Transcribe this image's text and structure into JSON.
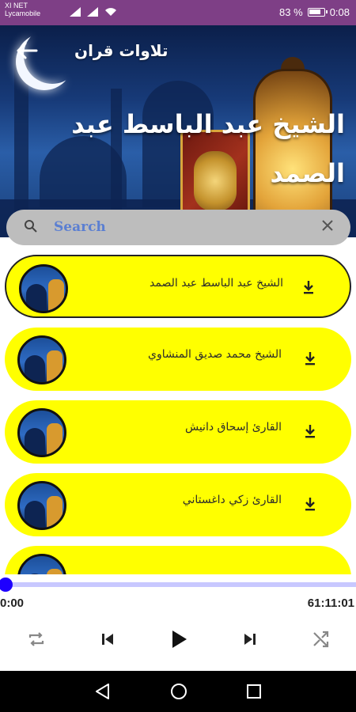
{
  "status_bar": {
    "carrier_line1": "XI NET",
    "carrier_line2": "Lycamobile",
    "battery_percent": "83 %",
    "time": "0:08"
  },
  "header": {
    "title": "تلاوات قران",
    "reciter_name": "الشيخ عبد الباسط عبد الصمد"
  },
  "search": {
    "placeholder": "Search"
  },
  "reciters": [
    {
      "name": "الشيخ عبد الباسط عبد الصمد",
      "selected": true
    },
    {
      "name": "الشيخ محمد صديق المنشاوي",
      "selected": false
    },
    {
      "name": "القارئ إسحاق دانيش",
      "selected": false
    },
    {
      "name": "القارئ زكي داغستاني",
      "selected": false
    },
    {
      "name": "",
      "selected": false
    }
  ],
  "player": {
    "current_time": "0:00",
    "total_time": "61:11:01",
    "progress": 0.0
  },
  "colors": {
    "status_bar": "#7e3f86",
    "item_background": "#ffff00",
    "seek_thumb": "#1e00ff",
    "seek_track": "#c8c8ff",
    "search_text": "#5b7fd2"
  },
  "icons": {
    "back": "arrow-left-icon",
    "search": "search-icon",
    "clear": "close-icon",
    "download": "download-icon",
    "repeat": "repeat-icon",
    "previous": "skip-previous-icon",
    "play": "play-icon",
    "next": "skip-next-icon",
    "shuffle": "shuffle-icon"
  }
}
